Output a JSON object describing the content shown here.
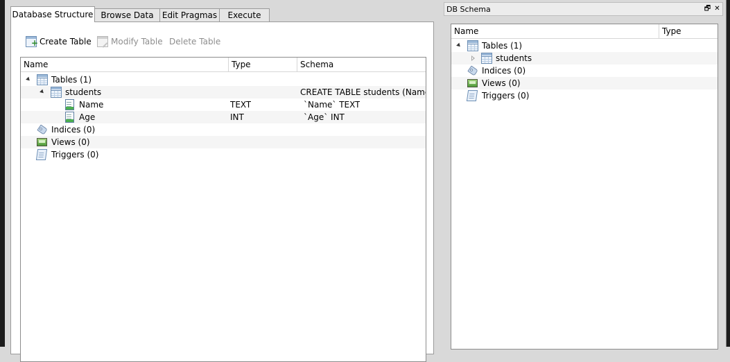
{
  "tabs": [
    {
      "label": "Database Structure",
      "active": true
    },
    {
      "label": "Browse Data",
      "active": false
    },
    {
      "label": "Edit Pragmas",
      "active": false
    },
    {
      "label": "Execute SQL",
      "active": false
    }
  ],
  "toolbar": {
    "create_table": "Create Table",
    "modify_table": "Modify Table",
    "delete_table": "Delete Table"
  },
  "structure_tree": {
    "columns": [
      "Name",
      "Type",
      "Schema"
    ],
    "rows": [
      {
        "name": "Tables (1)",
        "type": "",
        "schema": ""
      },
      {
        "name": "students",
        "type": "",
        "schema": "CREATE TABLE students (Name TE"
      },
      {
        "name": "Name",
        "type": "TEXT",
        "schema": "`Name` TEXT"
      },
      {
        "name": "Age",
        "type": "INT",
        "schema": "`Age` INT"
      },
      {
        "name": "Indices (0)",
        "type": "",
        "schema": ""
      },
      {
        "name": "Views (0)",
        "type": "",
        "schema": ""
      },
      {
        "name": "Triggers (0)",
        "type": "",
        "schema": ""
      }
    ]
  },
  "dock": {
    "title": "DB Schema",
    "float_icon": "float-icon",
    "close_icon": "close-icon",
    "columns": [
      "Name",
      "Type"
    ],
    "rows": [
      {
        "name": "Tables (1)"
      },
      {
        "name": "students"
      },
      {
        "name": "Indices (0)"
      },
      {
        "name": "Views (0)"
      },
      {
        "name": "Triggers (0)"
      }
    ]
  }
}
